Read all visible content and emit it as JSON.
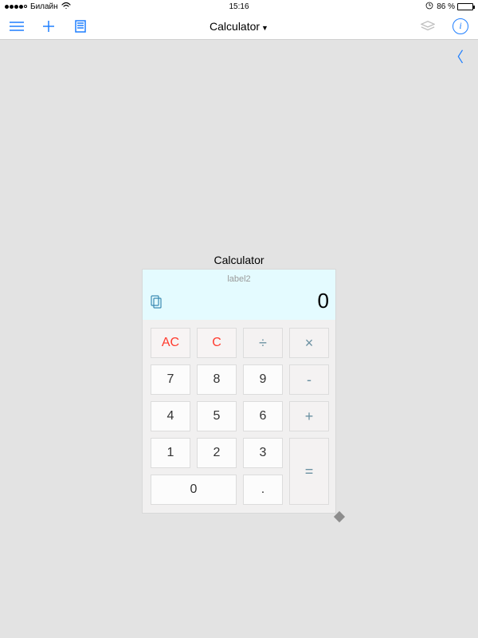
{
  "statusbar": {
    "carrier": "Билайн",
    "time": "15:16",
    "battery_pct": "86 %"
  },
  "navbar": {
    "title": "Calculator"
  },
  "back_chevron": "〈",
  "widget": {
    "title": "Calculator",
    "display_label": "label2",
    "display_value": "0",
    "keys": {
      "ac": "AC",
      "c": "C",
      "div": "÷",
      "mul": "×",
      "7": "7",
      "8": "8",
      "9": "9",
      "sub": "-",
      "4": "4",
      "5": "5",
      "6": "6",
      "add": "+",
      "1": "1",
      "2": "2",
      "3": "3",
      "eq": "=",
      "0": "0",
      "dot": "."
    }
  }
}
